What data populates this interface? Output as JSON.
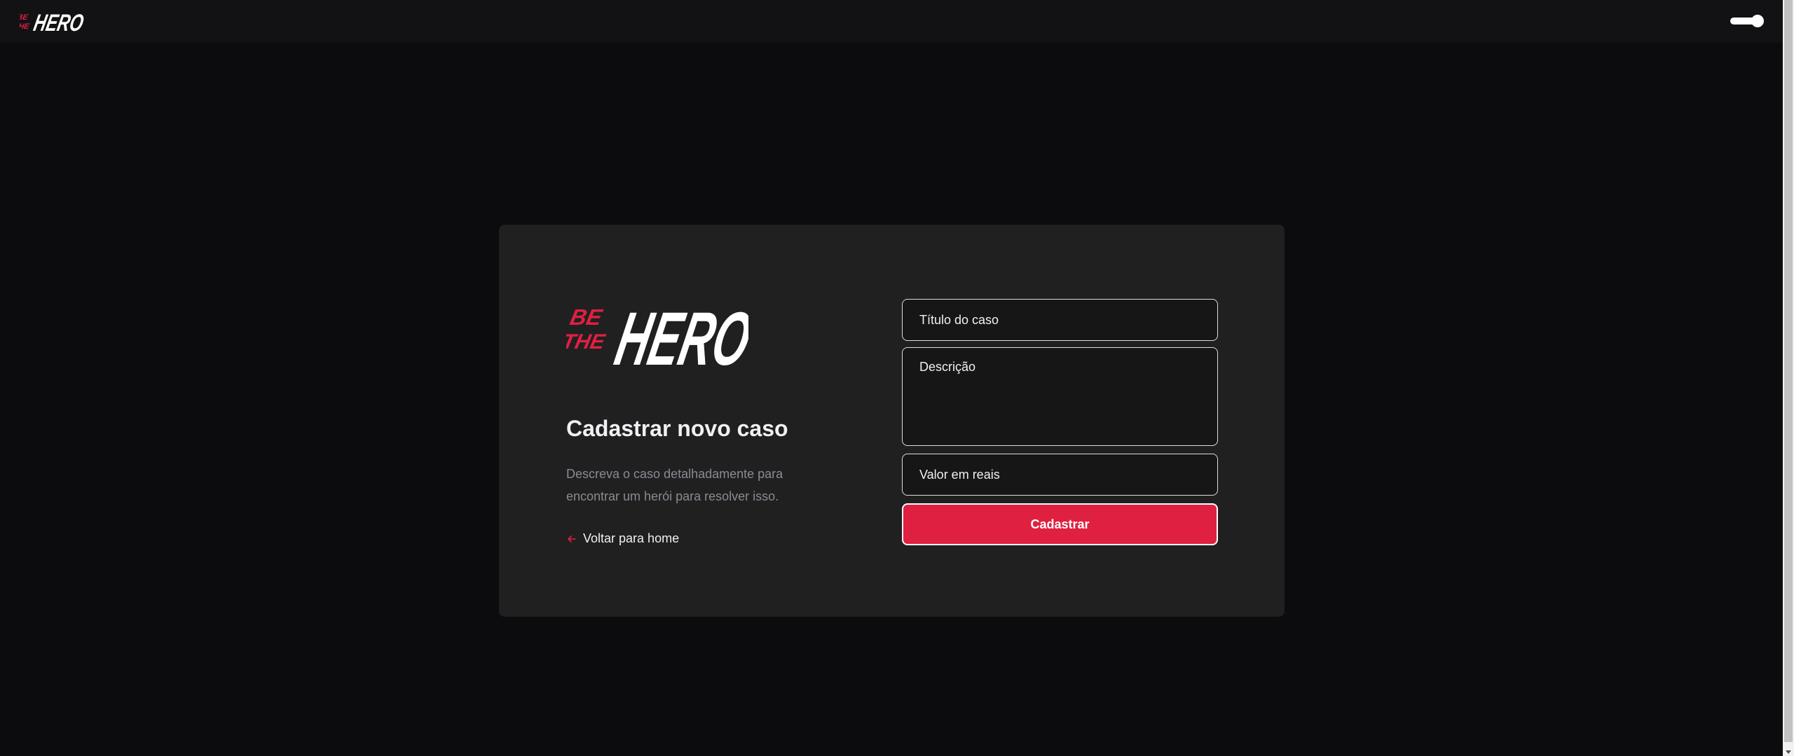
{
  "header": {
    "logo": {
      "small_text": "BE THE",
      "big_text": "HERO"
    },
    "theme_toggle": {
      "state": "on"
    }
  },
  "card": {
    "logo": {
      "small_text": "BE THE",
      "big_text": "HERO"
    },
    "title": "Cadastrar novo caso",
    "description": "Descreva o caso detalhadamente para encontrar um herói para resolver isso.",
    "back_link": {
      "label": "Voltar para home",
      "icon": "arrow-left-icon"
    }
  },
  "form": {
    "titulo": {
      "placeholder": "Título do caso",
      "value": ""
    },
    "descricao": {
      "placeholder": "Descrição",
      "value": ""
    },
    "valor": {
      "placeholder": "Valor em reais",
      "value": ""
    },
    "submit_label": "Cadastrar"
  },
  "colors": {
    "brand": "#e02041",
    "background": "#0c0b0d",
    "card": "#202020",
    "text": "#f0f0f5",
    "muted": "#8a8a95"
  }
}
